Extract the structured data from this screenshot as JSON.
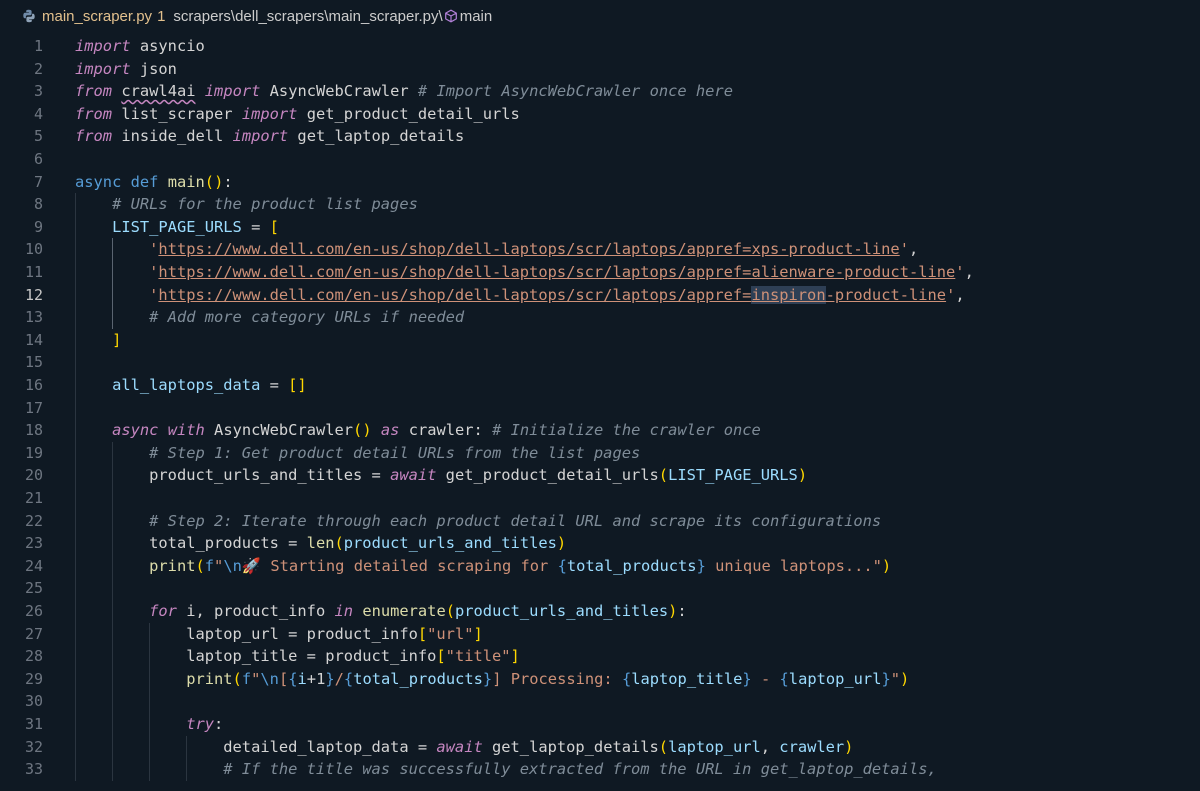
{
  "breadcrumb": {
    "file": "main_scraper.py",
    "problems": "1",
    "path": "scrapers\\dell_scrapers\\main_scraper.py\\",
    "symbol": "main",
    "icons": [
      "python-file-icon",
      "symbol-module-icon"
    ]
  },
  "editor": {
    "active_line": "12",
    "lines": [
      {
        "num": "1",
        "indent": 0,
        "tokens": [
          [
            "kwi",
            "import"
          ],
          [
            "",
            "&nbsp;asyncio"
          ]
        ]
      },
      {
        "num": "2",
        "indent": 0,
        "tokens": [
          [
            "kwi",
            "import"
          ],
          [
            "",
            "&nbsp;json"
          ]
        ]
      },
      {
        "num": "3",
        "indent": 0,
        "tokens": [
          [
            "kwi",
            "from"
          ],
          [
            "",
            " "
          ],
          [
            "squig",
            "crawl4ai"
          ],
          [
            "",
            " "
          ],
          [
            "kwi",
            "import"
          ],
          [
            "",
            " AsyncWebCrawler "
          ],
          [
            "cm",
            "# Import AsyncWebCrawler once here"
          ]
        ]
      },
      {
        "num": "4",
        "indent": 0,
        "tokens": [
          [
            "kwi",
            "from"
          ],
          [
            "",
            " list_scraper "
          ],
          [
            "kwi",
            "import"
          ],
          [
            "",
            " get_product_detail_urls"
          ]
        ]
      },
      {
        "num": "5",
        "indent": 0,
        "tokens": [
          [
            "kwi",
            "from"
          ],
          [
            "",
            " inside_dell "
          ],
          [
            "kwi",
            "import"
          ],
          [
            "",
            " get_laptop_details"
          ]
        ]
      },
      {
        "num": "6",
        "indent": 0,
        "tokens": []
      },
      {
        "num": "7",
        "indent": 0,
        "tokens": [
          [
            "st",
            "async"
          ],
          [
            "",
            " "
          ],
          [
            "st",
            "def"
          ],
          [
            "",
            " "
          ],
          [
            "fn",
            "main"
          ],
          [
            "br1",
            "()"
          ],
          [
            "",
            ":"
          ]
        ]
      },
      {
        "num": "8",
        "indent": 1,
        "tokens": [
          [
            "cm",
            "# URLs for the product list pages"
          ]
        ]
      },
      {
        "num": "9",
        "indent": 1,
        "tokens": [
          [
            "var",
            "LIST_PAGE_URLS"
          ],
          [
            "",
            " = "
          ],
          [
            "br1",
            "["
          ]
        ]
      },
      {
        "num": "10",
        "indent": 2,
        "tokens": [
          [
            "str",
            "'"
          ],
          [
            "str url",
            "https://www.dell.com/en-us/shop/dell-laptops/scr/laptops/appref=xps-product-line"
          ],
          [
            "str",
            "'"
          ],
          [
            "",
            ","
          ]
        ]
      },
      {
        "num": "11",
        "indent": 2,
        "tokens": [
          [
            "str",
            "'"
          ],
          [
            "str url",
            "https://www.dell.com/en-us/shop/dell-laptops/scr/laptops/appref=alienware-product-line"
          ],
          [
            "str",
            "'"
          ],
          [
            "",
            ","
          ]
        ]
      },
      {
        "num": "12",
        "indent": 2,
        "tokens": [
          [
            "str",
            "'"
          ],
          [
            "str url",
            "https://www.dell.com/en-us/shop/dell-laptops/scr/laptops/appref="
          ],
          [
            "str url hl",
            "inspiron"
          ],
          [
            "str url",
            "-product-line"
          ],
          [
            "str",
            "'"
          ],
          [
            "",
            ","
          ]
        ]
      },
      {
        "num": "13",
        "indent": 2,
        "tokens": [
          [
            "cm",
            "# Add more category URLs if needed"
          ]
        ]
      },
      {
        "num": "14",
        "indent": 1,
        "tokens": [
          [
            "br1",
            "]"
          ]
        ]
      },
      {
        "num": "15",
        "indent": 0,
        "tokens": []
      },
      {
        "num": "16",
        "indent": 1,
        "tokens": [
          [
            "var",
            "all_laptops_data"
          ],
          [
            "",
            " = "
          ],
          [
            "br1",
            "[]"
          ]
        ]
      },
      {
        "num": "17",
        "indent": 0,
        "tokens": []
      },
      {
        "num": "18",
        "indent": 1,
        "tokens": [
          [
            "kwi",
            "async"
          ],
          [
            "",
            " "
          ],
          [
            "kwi",
            "with"
          ],
          [
            "",
            " AsyncWebCrawler"
          ],
          [
            "br1",
            "()"
          ],
          [
            "",
            " "
          ],
          [
            "kwi",
            "as"
          ],
          [
            "",
            " crawler: "
          ],
          [
            "cm",
            "# Initialize the crawler once"
          ]
        ]
      },
      {
        "num": "19",
        "indent": 2,
        "tokens": [
          [
            "cm",
            "# Step 1: Get product detail URLs from the list pages"
          ]
        ]
      },
      {
        "num": "20",
        "indent": 2,
        "tokens": [
          [
            "",
            "product_urls_and_titles = "
          ],
          [
            "kwi",
            "await"
          ],
          [
            "",
            " get_product_detail_urls"
          ],
          [
            "br1",
            "("
          ],
          [
            "var",
            "LIST_PAGE_URLS"
          ],
          [
            "br1",
            ")"
          ]
        ]
      },
      {
        "num": "21",
        "indent": 0,
        "tokens": []
      },
      {
        "num": "22",
        "indent": 2,
        "tokens": [
          [
            "cm",
            "# Step 2: Iterate through each product detail URL and scrape its configurations"
          ]
        ]
      },
      {
        "num": "23",
        "indent": 2,
        "tokens": [
          [
            "",
            "total_products = "
          ],
          [
            "fn",
            "len"
          ],
          [
            "br1",
            "("
          ],
          [
            "var",
            "product_urls_and_titles"
          ],
          [
            "br1",
            ")"
          ]
        ]
      },
      {
        "num": "24",
        "indent": 2,
        "tokens": [
          [
            "fn",
            "print"
          ],
          [
            "br1",
            "("
          ],
          [
            "st",
            "f"
          ],
          [
            "str",
            "\""
          ],
          [
            "st",
            "\\n"
          ],
          [
            "",
            "🚀"
          ],
          [
            "str",
            " Starting detailed scraping for "
          ],
          [
            "st",
            "{"
          ],
          [
            "var",
            "total_products"
          ],
          [
            "st",
            "}"
          ],
          [
            "str",
            " unique laptops...\""
          ],
          [
            "br1",
            ")"
          ]
        ]
      },
      {
        "num": "25",
        "indent": 0,
        "tokens": []
      },
      {
        "num": "26",
        "indent": 2,
        "tokens": [
          [
            "kwi",
            "for"
          ],
          [
            "",
            " i, product_info "
          ],
          [
            "kwi",
            "in"
          ],
          [
            "",
            " "
          ],
          [
            "fn",
            "enumerate"
          ],
          [
            "br1",
            "("
          ],
          [
            "var",
            "product_urls_and_titles"
          ],
          [
            "br1",
            ")"
          ],
          [
            "",
            ":"
          ]
        ]
      },
      {
        "num": "27",
        "indent": 3,
        "tokens": [
          [
            "",
            "laptop_url = product_info"
          ],
          [
            "br1",
            "["
          ],
          [
            "str",
            "\"url\""
          ],
          [
            "br1",
            "]"
          ]
        ]
      },
      {
        "num": "28",
        "indent": 3,
        "tokens": [
          [
            "",
            "laptop_title = product_info"
          ],
          [
            "br1",
            "["
          ],
          [
            "str",
            "\"title\""
          ],
          [
            "br1",
            "]"
          ]
        ]
      },
      {
        "num": "29",
        "indent": 3,
        "tokens": [
          [
            "fn",
            "print"
          ],
          [
            "br1",
            "("
          ],
          [
            "st",
            "f"
          ],
          [
            "str",
            "\""
          ],
          [
            "st",
            "\\n"
          ],
          [
            "str",
            "["
          ],
          [
            "st",
            "{"
          ],
          [
            "var",
            "i"
          ],
          [
            "",
            "+"
          ],
          [
            "",
            "1"
          ],
          [
            "st",
            "}"
          ],
          [
            "str",
            "/"
          ],
          [
            "st",
            "{"
          ],
          [
            "var",
            "total_products"
          ],
          [
            "st",
            "}"
          ],
          [
            "str",
            "] Processing: "
          ],
          [
            "st",
            "{"
          ],
          [
            "var",
            "laptop_title"
          ],
          [
            "st",
            "}"
          ],
          [
            "str",
            " - "
          ],
          [
            "st",
            "{"
          ],
          [
            "var",
            "laptop_url"
          ],
          [
            "st",
            "}"
          ],
          [
            "str",
            "\""
          ],
          [
            "br1",
            ")"
          ]
        ]
      },
      {
        "num": "30",
        "indent": 0,
        "tokens": []
      },
      {
        "num": "31",
        "indent": 3,
        "tokens": [
          [
            "kwi",
            "try"
          ],
          [
            "",
            ":"
          ]
        ]
      },
      {
        "num": "32",
        "indent": 4,
        "tokens": [
          [
            "",
            "detailed_laptop_data = "
          ],
          [
            "kwi",
            "await"
          ],
          [
            "",
            " get_laptop_details"
          ],
          [
            "br1",
            "("
          ],
          [
            "var",
            "laptop_url"
          ],
          [
            "",
            ", "
          ],
          [
            "var",
            "crawler"
          ],
          [
            "br1",
            ")"
          ]
        ]
      },
      {
        "num": "33",
        "indent": 4,
        "tokens": [
          [
            "cm",
            "# If the title was successfully extracted from the URL in get_laptop_details,"
          ]
        ]
      }
    ]
  }
}
